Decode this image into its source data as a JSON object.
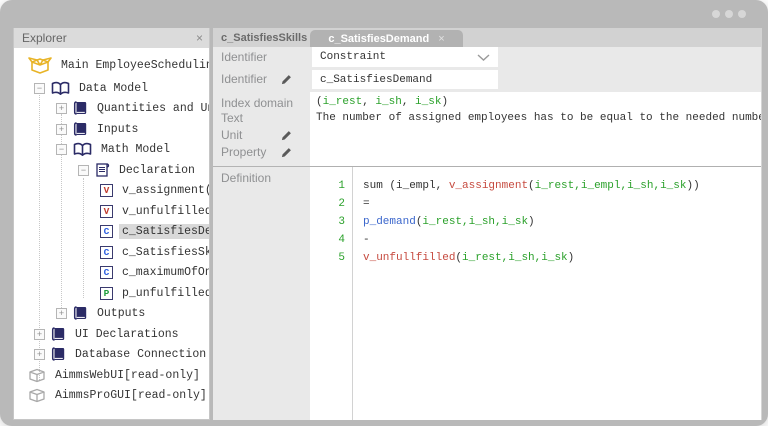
{
  "window": {
    "control_dot_count": 3
  },
  "explorer": {
    "title": "Explorer",
    "close_glyph": "×",
    "tree": [
      {
        "label": "Main EmployeeScheduling",
        "icon": "open-box",
        "level": 0
      },
      {
        "label": "Data Model",
        "icon": "open-book",
        "level": 1,
        "expand": "minus"
      },
      {
        "label": "Quantities and Units",
        "icon": "closed-book",
        "level": 2,
        "expand": "plus"
      },
      {
        "label": "Inputs",
        "icon": "closed-book",
        "level": 2,
        "expand": "plus"
      },
      {
        "label": "Math Model",
        "icon": "open-book",
        "level": 2,
        "expand": "minus"
      },
      {
        "label": "Declaration",
        "icon": "scroll",
        "level": 3,
        "expand": "minus"
      },
      {
        "label": "v_assignment(i_",
        "icon": "badge",
        "badge": "V",
        "badge_color": "#c0392b",
        "level": 4
      },
      {
        "label": "v_unfulfilled(i",
        "icon": "badge",
        "badge": "V",
        "badge_color": "#c0392b",
        "level": 4
      },
      {
        "label": "c_SatisfiesDema",
        "icon": "badge",
        "badge": "C",
        "badge_color": "#2e5fe0",
        "level": 4,
        "selected": true
      },
      {
        "label": "c_SatisfiesSkil",
        "icon": "badge",
        "badge": "C",
        "badge_color": "#2e5fe0",
        "level": 4
      },
      {
        "label": "c_maximumOfOneS",
        "icon": "badge",
        "badge": "C",
        "badge_color": "#2e5fe0",
        "level": 4
      },
      {
        "label": "p_unfulfilledWe",
        "icon": "badge",
        "badge": "P",
        "badge_color": "#1f9e3e",
        "level": 4
      },
      {
        "label": "Outputs",
        "icon": "closed-book",
        "level": 2,
        "expand": "plus"
      },
      {
        "label": "UI Declarations",
        "icon": "closed-book",
        "level": 1,
        "expand": "plus"
      },
      {
        "label": "Database Connection",
        "icon": "closed-book",
        "level": 1,
        "expand": "plus"
      },
      {
        "label": "AimmsWebUI[read-only]",
        "icon": "package",
        "level": 0
      },
      {
        "label": "AimmsProGUI[read-only]",
        "icon": "package",
        "level": 0
      }
    ]
  },
  "tabs": [
    {
      "label": "c_SatisfiesSkills",
      "active": false
    },
    {
      "label": "c_SatisfiesDemand",
      "active": true,
      "close_glyph": "×"
    }
  ],
  "properties": {
    "identifier_type_label": "Identifier",
    "identifier_type_value": "Constraint",
    "identifier_label": "Identifier",
    "identifier_value": "c_SatisfiesDemand",
    "index_domain_label": "Index domain",
    "index_domain_segments": [
      [
        "(",
        "plain"
      ],
      [
        "i_rest",
        "green"
      ],
      [
        ", ",
        "plain"
      ],
      [
        "i_sh",
        "green"
      ],
      [
        ", ",
        "plain"
      ],
      [
        "i_sk",
        "green"
      ],
      [
        ")",
        "plain"
      ]
    ],
    "text_label": "Text",
    "text_value": "The number of assigned employees has to be equal to the needed number of emplo",
    "unit_label": "Unit",
    "property_label": "Property",
    "definition_label": "Definition"
  },
  "definition_editor": {
    "lines": [
      {
        "num": "1",
        "segments": [
          [
            "sum (i_empl, ",
            "plain"
          ],
          [
            "v_assignment",
            "red"
          ],
          [
            "(",
            "plain"
          ],
          [
            "i_rest,i_empl,i_sh,i_sk",
            "green"
          ],
          [
            "))",
            "plain"
          ]
        ]
      },
      {
        "num": "2",
        "segments": [
          [
            "=",
            "plain"
          ]
        ]
      },
      {
        "num": "3",
        "segments": [
          [
            "p_demand",
            "blue"
          ],
          [
            "(",
            "plain"
          ],
          [
            "i_rest,i_sh,i_sk",
            "green"
          ],
          [
            ")",
            "plain"
          ]
        ]
      },
      {
        "num": "4",
        "segments": [
          [
            "-",
            "plain"
          ]
        ]
      },
      {
        "num": "5",
        "segments": [
          [
            "v_unfullfilled",
            "red"
          ],
          [
            "(",
            "plain"
          ],
          [
            "i_rest,i_sh,i_sk",
            "green"
          ],
          [
            ")",
            "plain"
          ]
        ]
      }
    ]
  },
  "colors": {
    "window_frame": "#b9b9b9",
    "tab_bar": "#d2d2d2",
    "active_tab": "#b2b2b2",
    "panel_label_bg": "#e9e9e9",
    "identifier_green": "#2ba12b",
    "variable_red": "#c64a3f",
    "parameter_blue": "#3a66cc",
    "icon_navy": "#2b2b66",
    "main_box_gold": "#e8b427"
  }
}
